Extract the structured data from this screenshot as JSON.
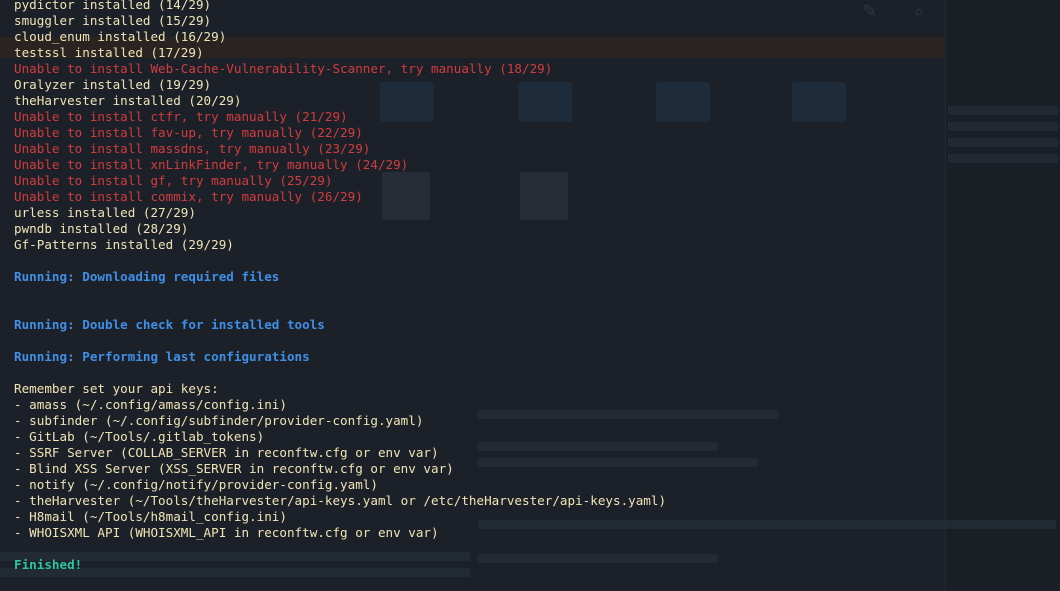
{
  "terminal": {
    "lines": [
      {
        "kind": "ok",
        "text": "pydictor installed (14/29)"
      },
      {
        "kind": "ok",
        "text": "smuggler installed (15/29)"
      },
      {
        "kind": "ok",
        "text": "cloud_enum installed (16/29)"
      },
      {
        "kind": "ok",
        "text": "testssl installed (17/29)"
      },
      {
        "kind": "err",
        "text": "Unable to install Web-Cache-Vulnerability-Scanner, try manually (18/29)"
      },
      {
        "kind": "ok",
        "text": "Oralyzer installed (19/29)"
      },
      {
        "kind": "ok",
        "text": "theHarvester installed (20/29)"
      },
      {
        "kind": "err",
        "text": "Unable to install ctfr, try manually (21/29)"
      },
      {
        "kind": "err",
        "text": "Unable to install fav-up, try manually (22/29)"
      },
      {
        "kind": "err",
        "text": "Unable to install massdns, try manually (23/29)"
      },
      {
        "kind": "err",
        "text": "Unable to install xnLinkFinder, try manually (24/29)"
      },
      {
        "kind": "err",
        "text": "Unable to install gf, try manually (25/29)"
      },
      {
        "kind": "err",
        "text": "Unable to install commix, try manually (26/29)"
      },
      {
        "kind": "ok",
        "text": "urless installed (27/29)"
      },
      {
        "kind": "ok",
        "text": "pwndb installed (28/29)"
      },
      {
        "kind": "ok",
        "text": "Gf-Patterns installed (29/29)"
      },
      {
        "kind": "blank",
        "text": ""
      },
      {
        "kind": "info",
        "text": "Running: Downloading required files"
      },
      {
        "kind": "blank",
        "text": ""
      },
      {
        "kind": "blank",
        "text": ""
      },
      {
        "kind": "info",
        "text": "Running: Double check for installed tools"
      },
      {
        "kind": "blank",
        "text": ""
      },
      {
        "kind": "info",
        "text": "Running: Performing last configurations"
      },
      {
        "kind": "blank",
        "text": ""
      },
      {
        "kind": "plain",
        "text": "Remember set your api keys:"
      },
      {
        "kind": "plain",
        "text": "- amass (~/.config/amass/config.ini)"
      },
      {
        "kind": "plain",
        "text": "- subfinder (~/.config/subfinder/provider-config.yaml)"
      },
      {
        "kind": "plain",
        "text": "- GitLab (~/Tools/.gitlab_tokens)"
      },
      {
        "kind": "plain",
        "text": "- SSRF Server (COLLAB_SERVER in reconftw.cfg or env var)"
      },
      {
        "kind": "plain",
        "text": "- Blind XSS Server (XSS_SERVER in reconftw.cfg or env var)"
      },
      {
        "kind": "plain",
        "text": "- notify (~/.config/notify/provider-config.yaml)"
      },
      {
        "kind": "plain",
        "text": "- theHarvester (~/Tools/theHarvester/api-keys.yaml or /etc/theHarvester/api-keys.yaml)"
      },
      {
        "kind": "plain",
        "text": "- H8mail (~/Tools/h8mail_config.ini)"
      },
      {
        "kind": "plain",
        "text": "- WHOISXML API (WHOISXML_API in reconftw.cfg or env var)"
      },
      {
        "kind": "blank",
        "text": ""
      },
      {
        "kind": "done",
        "text": "Finished!"
      }
    ]
  },
  "colors": {
    "background": "#1c2129",
    "installed": "#f0e4b4",
    "error": "#d23c3c",
    "running": "#3f8fe6",
    "finished": "#2ec49f"
  }
}
